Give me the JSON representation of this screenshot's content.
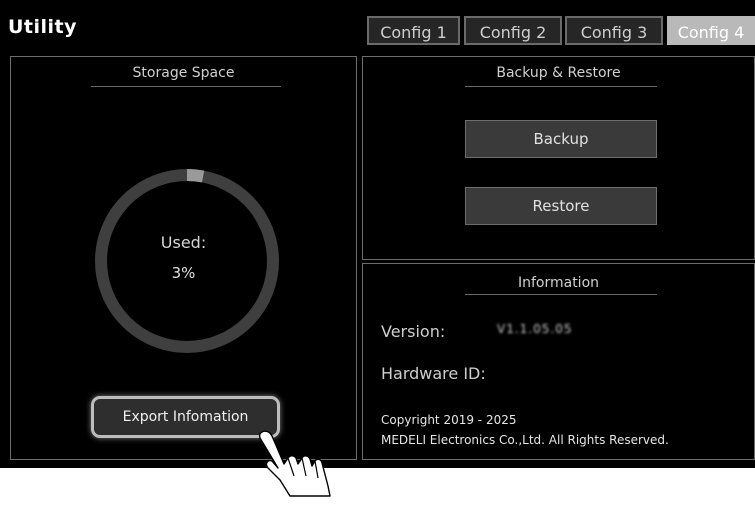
{
  "app": {
    "title": "Utility"
  },
  "tabs": [
    {
      "label": "Config 1",
      "active": false
    },
    {
      "label": "Config 2",
      "active": false
    },
    {
      "label": "Config 3",
      "active": false
    },
    {
      "label": "Config 4",
      "active": true
    }
  ],
  "storage": {
    "title": "Storage Space",
    "used_label": "Used:",
    "used_value": "3%",
    "used_fraction": 0.03,
    "export_button": "Export Infomation"
  },
  "backup": {
    "title": "Backup & Restore",
    "backup_button": "Backup",
    "restore_button": "Restore"
  },
  "info": {
    "title": "Information",
    "version_label": "Version:",
    "version_value": "V1.1.05.05",
    "hardware_label": "Hardware ID:",
    "copyright_line1": "Copyright 2019 - 2025",
    "copyright_line2": "MEDELI Electronics Co.,Ltd. All Rights Reserved."
  },
  "colors": {
    "background": "#000000",
    "tab_active": "#b9b9b9",
    "ring": "#3f3f3f",
    "ring_used": "#9a9a9a"
  }
}
